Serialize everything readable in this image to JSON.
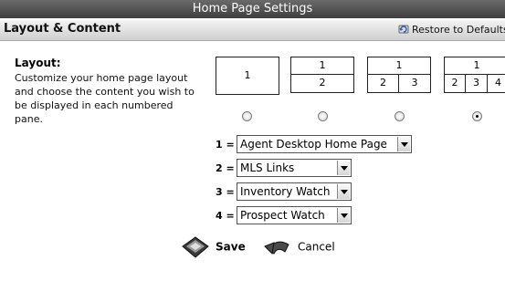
{
  "window": {
    "title": "Home Page Settings"
  },
  "section": {
    "title": "Layout & Content",
    "restore_label": "Restore to Defaults"
  },
  "layout": {
    "label": "Layout:",
    "description": "Customize your home page layout and choose the content you wish to be displayed in each numbered pane.",
    "options": [
      {
        "top": [
          "1"
        ],
        "bottom": [],
        "selected": false
      },
      {
        "top": [
          "1"
        ],
        "bottom": [
          "2"
        ],
        "selected": false
      },
      {
        "top": [
          "1"
        ],
        "bottom": [
          "2",
          "3"
        ],
        "selected": false
      },
      {
        "top": [
          "1"
        ],
        "bottom": [
          "2",
          "3",
          "4"
        ],
        "selected": true
      }
    ]
  },
  "panes": [
    {
      "label": "1 =",
      "value": "Agent Desktop Home Page"
    },
    {
      "label": "2 =",
      "value": "MLS Links"
    },
    {
      "label": "3 =",
      "value": "Inventory Watch"
    },
    {
      "label": "4 =",
      "value": "Prospect Watch"
    }
  ],
  "actions": {
    "save_label": "Save",
    "cancel_label": "Cancel"
  }
}
